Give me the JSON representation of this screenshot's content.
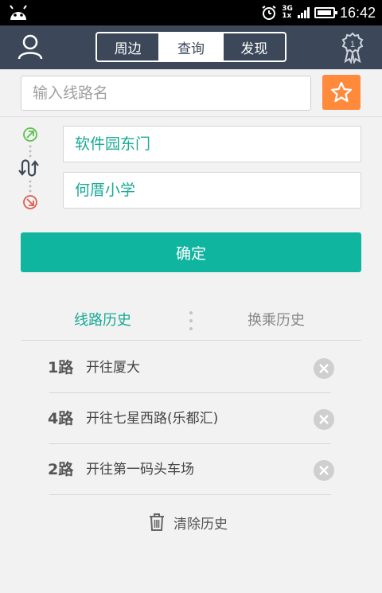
{
  "status_bar": {
    "time": "16:42",
    "network_top": "3G",
    "network_bottom": "1x"
  },
  "header": {
    "tabs": [
      {
        "label": "周边",
        "active": false
      },
      {
        "label": "查询",
        "active": true
      },
      {
        "label": "发现",
        "active": false
      }
    ],
    "medal_count": "1"
  },
  "search": {
    "placeholder": "输入线路名"
  },
  "route": {
    "from": "软件园东门",
    "to": "何厝小学"
  },
  "confirm_label": "确定",
  "history_tabs": {
    "line": "线路历史",
    "transfer": "换乘历史"
  },
  "history": [
    {
      "number": "1路",
      "direction": "开往厦大"
    },
    {
      "number": "4路",
      "direction": "开往七星西路(乐都汇)"
    },
    {
      "number": "2路",
      "direction": "开往第一码头车场"
    }
  ],
  "clear_label": "清除历史",
  "colors": {
    "header": "#3c4859",
    "accent": "#0fb59f",
    "favorite": "#ff8a3c"
  }
}
